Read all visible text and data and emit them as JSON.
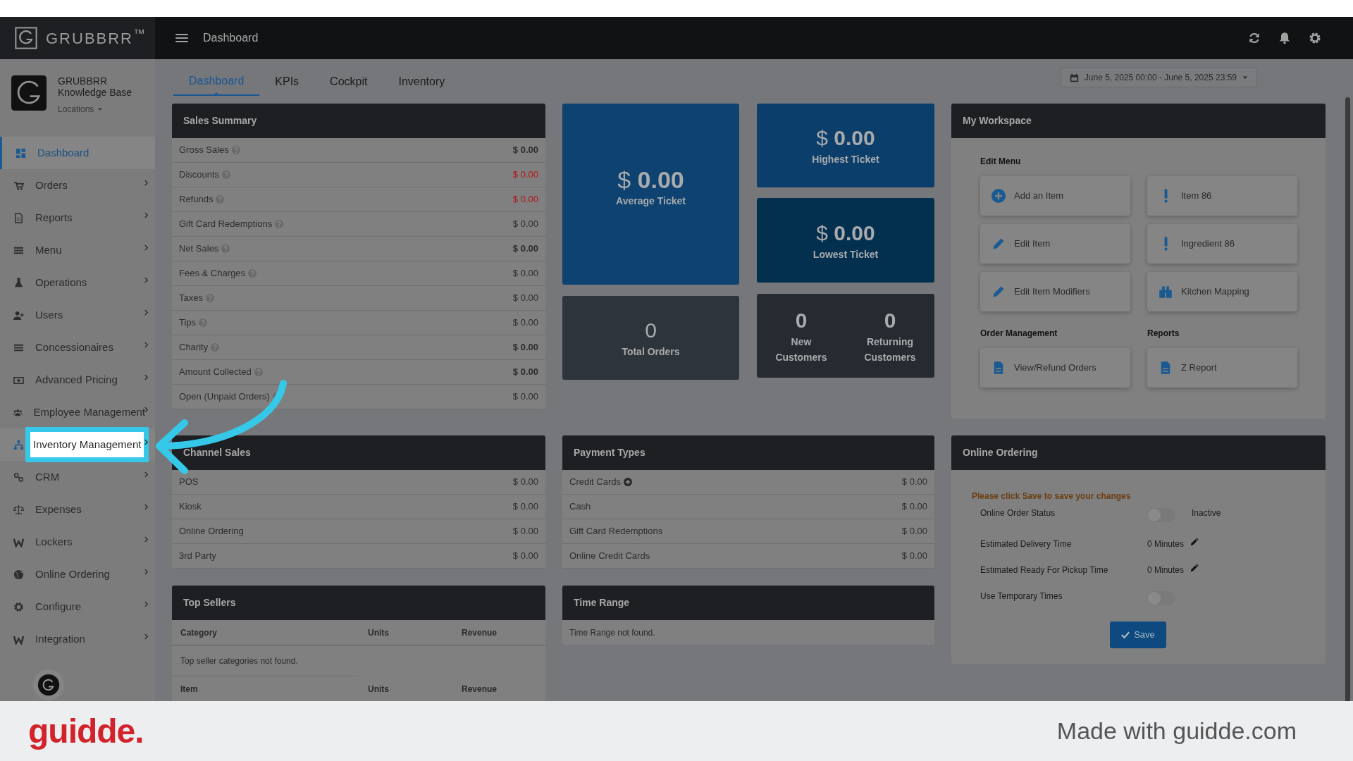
{
  "brand": {
    "logo_text": "GRUBBRR$^{™}$"
  },
  "header": {
    "title": "Dashboard"
  },
  "profile": {
    "name": "GRUBBRR Knowledge Base",
    "locations": "Locations"
  },
  "sidebar": {
    "items": [
      {
        "label": "Dashboard",
        "selected": true,
        "highlighted": false,
        "has_submenu": false
      },
      {
        "label": "Orders",
        "selected": false,
        "highlighted": false,
        "has_submenu": true
      },
      {
        "label": "Reports",
        "selected": false,
        "highlighted": false,
        "has_submenu": true
      },
      {
        "label": "Menu",
        "selected": false,
        "highlighted": false,
        "has_submenu": true
      },
      {
        "label": "Operations",
        "selected": false,
        "highlighted": false,
        "has_submenu": true
      },
      {
        "label": "Users",
        "selected": false,
        "highlighted": false,
        "has_submenu": true
      },
      {
        "label": "Concessionaires",
        "selected": false,
        "highlighted": false,
        "has_submenu": true
      },
      {
        "label": "Advanced Pricing",
        "selected": false,
        "highlighted": false,
        "has_submenu": true
      },
      {
        "label": "Employee Management",
        "selected": false,
        "highlighted": false,
        "has_submenu": true
      },
      {
        "label": "Inventory Management",
        "selected": false,
        "highlighted": true,
        "has_submenu": true
      },
      {
        "label": "CRM",
        "selected": false,
        "highlighted": false,
        "has_submenu": true
      },
      {
        "label": "Expenses",
        "selected": false,
        "highlighted": false,
        "has_submenu": true
      },
      {
        "label": "Lockers",
        "selected": false,
        "highlighted": false,
        "has_submenu": true
      },
      {
        "label": "Online Ordering",
        "selected": false,
        "highlighted": false,
        "has_submenu": true
      },
      {
        "label": "Configure",
        "selected": false,
        "highlighted": false,
        "has_submenu": true
      },
      {
        "label": "Integration",
        "selected": false,
        "highlighted": false,
        "has_submenu": true
      }
    ]
  },
  "tabs": [
    {
      "label": "Dashboard",
      "selected": true
    },
    {
      "label": "KPIs",
      "selected": false
    },
    {
      "label": "Cockpit",
      "selected": false
    },
    {
      "label": "Inventory",
      "selected": false
    }
  ],
  "date_range": "June 5, 2025 00:00 - June 5, 2025 23:59",
  "sales_summary": {
    "title": "Sales Summary",
    "rows": [
      {
        "label": "Gross Sales",
        "value": "$ 0.00",
        "emphasis": true,
        "negative": false
      },
      {
        "label": "Discounts",
        "value": "$ 0.00",
        "emphasis": false,
        "negative": true
      },
      {
        "label": "Refunds",
        "value": "$ 0.00",
        "emphasis": false,
        "negative": true
      },
      {
        "label": "Gift Card Redemptions",
        "value": "$ 0.00",
        "emphasis": false,
        "negative": false
      },
      {
        "label": "Net Sales",
        "value": "$ 0.00",
        "emphasis": true,
        "negative": false
      },
      {
        "label": "Fees & Charges",
        "value": "$ 0.00",
        "emphasis": false,
        "negative": false
      },
      {
        "label": "Taxes",
        "value": "$ 0.00",
        "emphasis": false,
        "negative": false
      },
      {
        "label": "Tips",
        "value": "$ 0.00",
        "emphasis": false,
        "negative": false
      },
      {
        "label": "Charity",
        "value": "$ 0.00",
        "emphasis": true,
        "negative": false
      },
      {
        "label": "Amount Collected",
        "value": "$ 0.00",
        "emphasis": true,
        "negative": false
      },
      {
        "label": "Open (Unpaid Orders)",
        "value": "$ 0.00",
        "emphasis": false,
        "negative": false
      }
    ]
  },
  "tiles": {
    "average": {
      "value": "$ **0.00**",
      "label": "Average Ticket",
      "color": "#0d4271"
    },
    "highest": {
      "value": "$ **0.00**",
      "label": "Highest Ticket",
      "color": "#0b3e6b"
    },
    "lowest": {
      "value": "$ **0.00**",
      "label": "Lowest Ticket",
      "color": "#04304f"
    },
    "total_orders": {
      "value": "0",
      "label": "Total Orders",
      "color": "#2e343b"
    },
    "customers": {
      "color": "#252b30",
      "parts": [
        {
          "value": "0",
          "label": "New Customers"
        },
        {
          "value": "0",
          "label": "Returning Customers"
        }
      ]
    }
  },
  "workspace": {
    "title": "My Workspace",
    "edit_menu": {
      "title": "Edit Menu",
      "items": [
        "Add an Item",
        "Item 86",
        "Edit Item",
        "Ingredient 86",
        "Edit Item Modifiers",
        "Kitchen Mapping"
      ]
    },
    "groups": [
      {
        "title": "Order Management",
        "items": [
          "View/Refund Orders"
        ]
      },
      {
        "title": "Reports",
        "items": [
          "Z Report"
        ]
      }
    ]
  },
  "channel_sales": {
    "title": "Channel Sales",
    "rows": [
      {
        "label": "POS",
        "value": "$ 0.00"
      },
      {
        "label": "Kiosk",
        "value": "$ 0.00"
      },
      {
        "label": "Online Ordering",
        "value": "$ 0.00"
      },
      {
        "label": "3rd Party",
        "value": "$ 0.00"
      }
    ]
  },
  "payment_types": {
    "title": "Payment Types",
    "rows": [
      {
        "label": "Credit Cards",
        "value": "$ 0.00",
        "expandable": true
      },
      {
        "label": "Cash",
        "value": "$ 0.00",
        "expandable": false
      },
      {
        "label": "Gift Card Redemptions",
        "value": "$ 0.00",
        "expandable": false
      },
      {
        "label": "Online Credit Cards",
        "value": "$ 0.00",
        "expandable": false
      }
    ]
  },
  "top_sellers": {
    "title": "Top Sellers",
    "columns": [
      "Category",
      "Units",
      "Revenue"
    ],
    "empty": "Top seller categories not found.",
    "columns_2": [
      "Item",
      "Units",
      "Revenue"
    ]
  },
  "time_range": {
    "title": "Time Range",
    "empty": "Time Range not found."
  },
  "online_ordering": {
    "title": "Online Ordering",
    "notice": "Please click Save to save your changes",
    "rows": [
      {
        "kind": "toggle",
        "label": "Online Order Status",
        "on": false,
        "state_label": "Inactive"
      },
      {
        "kind": "time",
        "label": "Estimated Delivery Time",
        "value": "0 Minutes"
      },
      {
        "kind": "time",
        "label": "Estimated Ready For Pickup Time",
        "value": "0 Minutes"
      },
      {
        "kind": "toggle",
        "label": "Use Temporary Times",
        "on": false
      }
    ],
    "save": "Save"
  },
  "footer": {
    "brand": "guidde.",
    "credit": "Made with guidde.com"
  }
}
